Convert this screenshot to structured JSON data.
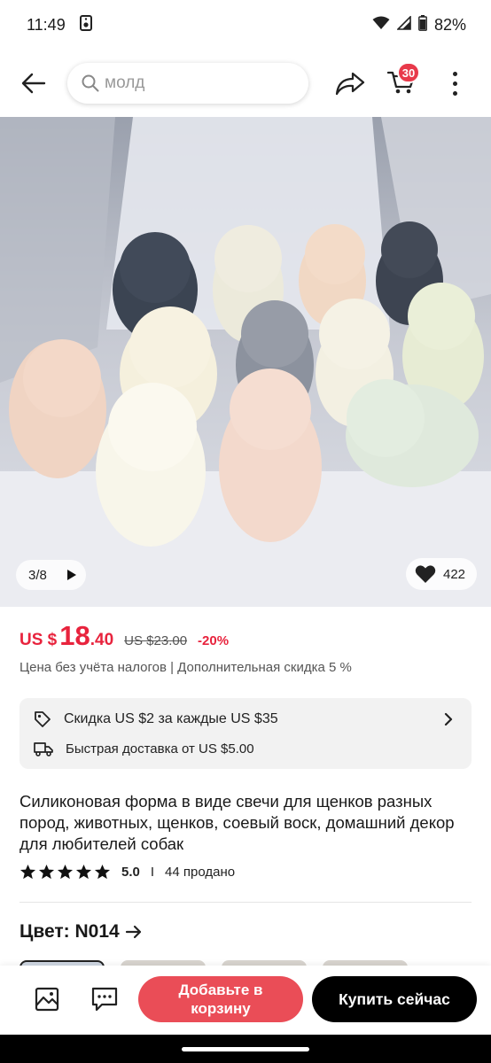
{
  "status_bar": {
    "time": "11:49",
    "battery": "82%"
  },
  "header": {
    "search_placeholder": "молд",
    "cart_count": "30"
  },
  "gallery": {
    "counter": "3/8",
    "likes": "422"
  },
  "price": {
    "currency": "US $",
    "integer": "18",
    "decimal": ".40",
    "old_price": "US $23.00",
    "discount": "-20%",
    "tax_note": "Цена без учёта налогов | Дополнительная скидка 5 %"
  },
  "promo": {
    "discount_text": "Скидка US $2 за каждые US $35",
    "shipping_text": "Быстрая доставка от US $5.00"
  },
  "product": {
    "title": "Силиконовая форма в виде свечи для щенков разных пород, животных, щенков, соевый воск, домашний декор для любителей собак",
    "rating": "5.0",
    "rating_separator": "I",
    "sold": "44 продано",
    "stars": 5
  },
  "variant": {
    "color_label": "Цвет: N014"
  },
  "actions": {
    "add_to_cart": "Добавьте в корзину",
    "buy_now": "Купить сейчас"
  },
  "colors": {
    "accent": "#e8233d",
    "cart_button": "#ea4d57",
    "buy_button": "#000000"
  }
}
